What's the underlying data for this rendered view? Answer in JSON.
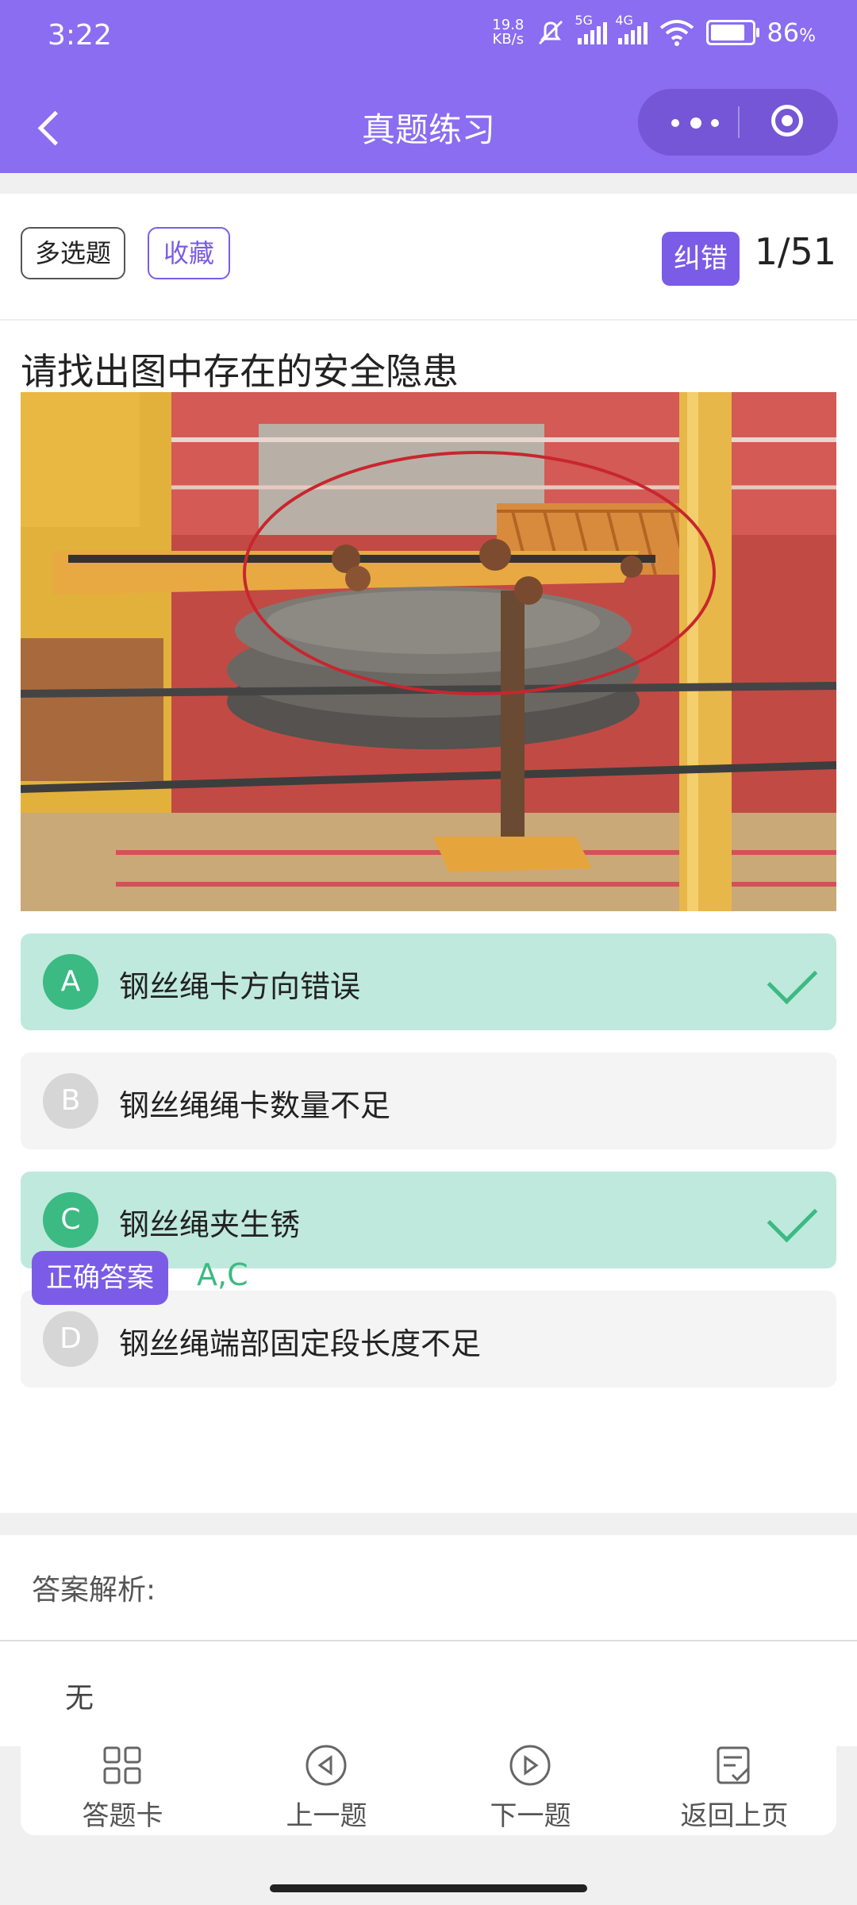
{
  "status_bar": {
    "time": "3:22",
    "net_speed_value": "19.8",
    "net_speed_unit": "KB/s",
    "sig1_tag": "5G",
    "sig2_tag": "4G",
    "battery_pct": "86",
    "battery_unit": "%"
  },
  "nav": {
    "title": "真题练习"
  },
  "question_header": {
    "type_label": "多选题",
    "favorite_label": "收藏",
    "report_error_label": "纠错",
    "counter": "1/51"
  },
  "question": {
    "text": "请找出图中存在的安全隐患"
  },
  "options": [
    {
      "letter": "A",
      "text": "钢丝绳卡方向错误",
      "correct": true
    },
    {
      "letter": "B",
      "text": "钢丝绳绳卡数量不足",
      "correct": false
    },
    {
      "letter": "C",
      "text": "钢丝绳夹生锈",
      "correct": true
    },
    {
      "letter": "D",
      "text": "钢丝绳端部固定段长度不足",
      "correct": false
    }
  ],
  "answer": {
    "badge_label": "正确答案",
    "value": "A,C"
  },
  "analysis": {
    "label": "答案解析:",
    "value": "无"
  },
  "bottom_bar": {
    "answer_card": "答题卡",
    "prev": "上一题",
    "next": "下一题",
    "back_page": "返回上页"
  },
  "colors": {
    "primary": "#8a6df0",
    "accent": "#7b5ce6",
    "correct_bg": "#bfe9dc",
    "correct_green": "#3bba83"
  },
  "icons": [
    "back-arrow-icon",
    "more-dots-icon",
    "target-icon",
    "check-icon",
    "grid-icon",
    "prev-icon",
    "next-icon",
    "return-icon"
  ]
}
